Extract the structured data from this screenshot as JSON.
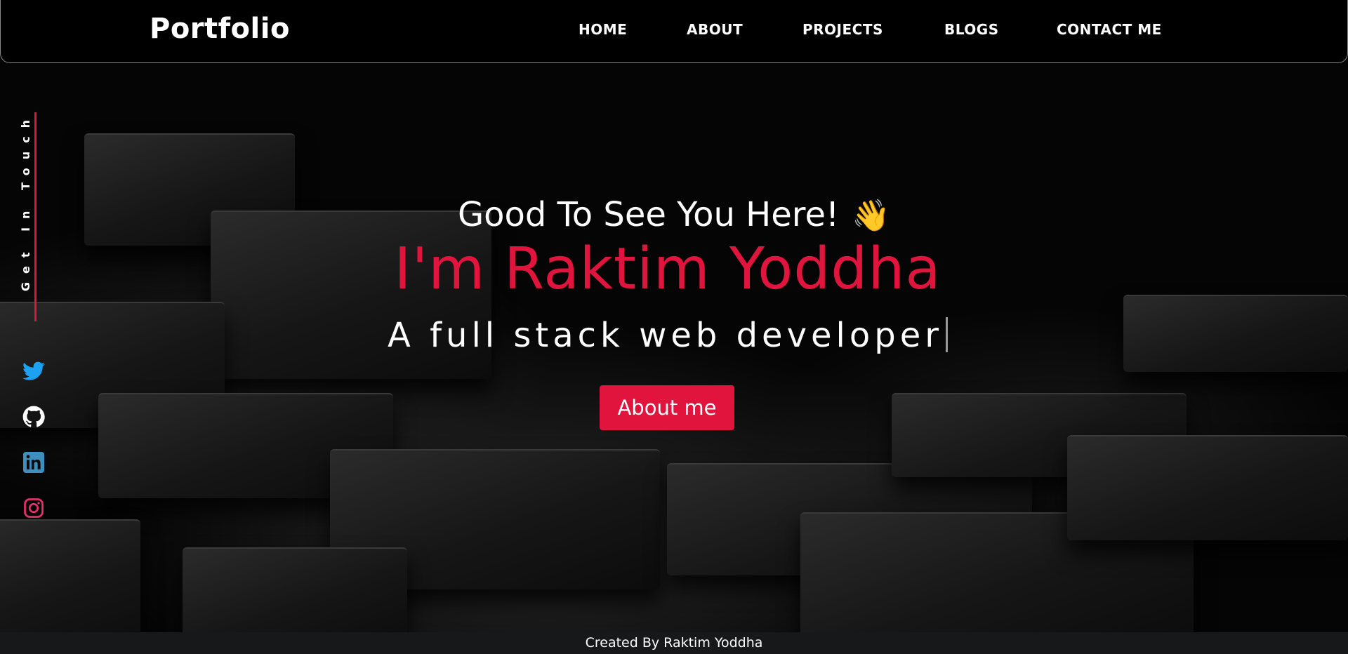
{
  "nav": {
    "logo": "Portfolio",
    "links": [
      "HOME",
      "ABOUT",
      "PROJECTS",
      "BLOGS",
      "CONTACT ME"
    ]
  },
  "side": {
    "get_in_touch": "Get In Touch",
    "socials": [
      "twitter-icon",
      "github-icon",
      "linkedin-icon",
      "instagram-icon"
    ]
  },
  "hero": {
    "greeting": "Good To See You Here!",
    "wave": "👋",
    "name": "I'm Raktim Yoddha",
    "role": "A full stack web developer",
    "button": "About me"
  },
  "footer": {
    "text": "Created By Raktim Yoddha"
  },
  "colors": {
    "accent": "#e0143c",
    "background": "#000000",
    "footer_bg": "#161819",
    "twitter": "#1da1f2",
    "linkedin": "#3d8fc2",
    "instagram": "#e1306c"
  }
}
